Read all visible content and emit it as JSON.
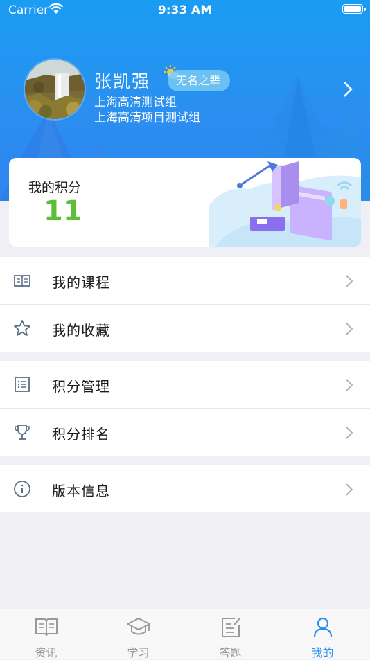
{
  "status_bar": {
    "carrier": "Carrier",
    "time": "9:33 AM"
  },
  "profile": {
    "name": "张凯强",
    "rank": "无名之辈",
    "group1": "上海高清测试组",
    "group2": "上海高清项目测试组"
  },
  "points": {
    "label": "我的积分",
    "value": "11"
  },
  "menu_groups": [
    {
      "items": [
        {
          "label": "我的课程",
          "icon": "book-icon"
        },
        {
          "label": "我的收藏",
          "icon": "star-icon"
        }
      ]
    },
    {
      "items": [
        {
          "label": "积分管理",
          "icon": "list-icon"
        },
        {
          "label": "积分排名",
          "icon": "trophy-icon"
        }
      ]
    },
    {
      "items": [
        {
          "label": "版本信息",
          "icon": "info-icon"
        }
      ]
    }
  ],
  "tabs": [
    {
      "label": "资讯",
      "icon": "news-icon",
      "active": false
    },
    {
      "label": "学习",
      "icon": "graduation-cap-icon",
      "active": false
    },
    {
      "label": "答题",
      "icon": "answer-icon",
      "active": false
    },
    {
      "label": "我的",
      "icon": "person-icon",
      "active": true
    }
  ],
  "colors": {
    "header": "#2a8ff0",
    "accent": "#2a8ff0",
    "points": "#5bbf3a"
  }
}
